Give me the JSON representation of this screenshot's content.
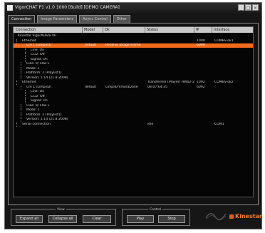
{
  "window": {
    "title": "VigorCHAT P1 v1.0 1000 [Build] [DEMO CAMERA]",
    "close": "×",
    "minimize": "_",
    "maximize": "□"
  },
  "tabs": [
    {
      "label": "Connection",
      "active": true
    },
    {
      "label": "Image Parameters",
      "active": false
    },
    {
      "label": "Async Control",
      "active": false
    },
    {
      "label": "Other",
      "active": false
    }
  ],
  "grid": {
    "headers": [
      "Connection",
      "Model",
      "Ok",
      "Status",
      "IP",
      "Interface"
    ],
    "rows": [
      {
        "c0": "Kinestar VigorXData VP",
        "c1": "",
        "c2": "",
        "c3": "",
        "c4": "",
        "c5": "",
        "indent": 0,
        "selected": false
      },
      {
        "c0": "Ethernet",
        "c1": "",
        "c2": "",
        "c3": "",
        "c4": "1000",
        "c5": "COMBv-ok1",
        "indent": 1,
        "selected": false
      },
      {
        "c0": "Cm 1 (Limpid1)",
        "c1": "default",
        "c2": "Receive image Frame",
        "c3": "",
        "c4": "6090",
        "c5": "",
        "indent": 2,
        "selected": true
      },
      {
        "c0": "Line: On",
        "c1": "",
        "c2": "",
        "c3": "",
        "c4": "",
        "c5": "",
        "indent": 3,
        "selected": false
      },
      {
        "c0": "CCD: Off",
        "c1": "",
        "c2": "",
        "c3": "",
        "c4": "",
        "c5": "",
        "indent": 3,
        "selected": false
      },
      {
        "c0": "Signal: On",
        "c1": "",
        "c2": "",
        "c3": "",
        "c4": "",
        "c5": "",
        "indent": 3,
        "selected": false
      },
      {
        "c0": "Clas: 0/ Clas L",
        "c1": "",
        "c2": "",
        "c3": "",
        "c4": "",
        "c5": "",
        "indent": 2,
        "selected": false
      },
      {
        "c0": "Mode: 1",
        "c1": "",
        "c2": "",
        "c3": "",
        "c4": "",
        "c5": "",
        "indent": 2,
        "selected": false
      },
      {
        "c0": "Platform: 2 (Playlist1)",
        "c1": "",
        "c2": "",
        "c3": "",
        "c4": "",
        "c5": "",
        "indent": 2,
        "selected": false
      },
      {
        "c0": "Version: 1.14 (21.8.2008)",
        "c1": "",
        "c2": "",
        "c3": "",
        "c4": "",
        "c5": "",
        "indent": 2,
        "selected": false
      },
      {
        "c0": "Ethernet",
        "c1": "",
        "c2": "",
        "c3": "Transferred TPlayer/ HW02-2",
        "c4": "1092",
        "c5": "COMBv-ok2",
        "indent": 1,
        "selected": false
      },
      {
        "c0": "Cm 1 (Limpid2)",
        "c1": "default",
        "c2": "Limpid/mmoraDone",
        "c3": "08:07:64:35",
        "c4": "6092",
        "c5": "",
        "indent": 2,
        "selected": false
      },
      {
        "c0": "Line: On",
        "c1": "",
        "c2": "",
        "c3": "",
        "c4": "",
        "c5": "",
        "indent": 3,
        "selected": false
      },
      {
        "c0": "CCD: Off",
        "c1": "",
        "c2": "",
        "c3": "",
        "c4": "",
        "c5": "",
        "indent": 3,
        "selected": false
      },
      {
        "c0": "Signal: On",
        "c1": "",
        "c2": "",
        "c3": "",
        "c4": "",
        "c5": "",
        "indent": 3,
        "selected": false
      },
      {
        "c0": "Clas: 0/ Clas L",
        "c1": "",
        "c2": "",
        "c3": "",
        "c4": "",
        "c5": "",
        "indent": 2,
        "selected": false
      },
      {
        "c0": "Mode: 1",
        "c1": "",
        "c2": "",
        "c3": "",
        "c4": "",
        "c5": "",
        "indent": 2,
        "selected": false
      },
      {
        "c0": "Platform: 2 (Playlist1)",
        "c1": "",
        "c2": "",
        "c3": "",
        "c4": "",
        "c5": "",
        "indent": 2,
        "selected": false
      },
      {
        "c0": "Version: 1.14 (21.8.2008)",
        "c1": "",
        "c2": "",
        "c3": "",
        "c4": "",
        "c5": "",
        "indent": 2,
        "selected": false
      },
      {
        "c0": "Serial connection",
        "c1": "",
        "c2": "",
        "c3": "idle",
        "c4": "",
        "c5": "COM1",
        "indent": 1,
        "selected": false
      }
    ]
  },
  "groups": {
    "view_label": "View",
    "control_label": "Control",
    "expand_all": "Expand all",
    "collapse_all": "Collapse all",
    "clear": "Clear",
    "play": "Play",
    "stop": "Stop"
  },
  "logo": {
    "text": "Kinestar"
  },
  "colors": {
    "selection": "#f26a1b",
    "logo": "#f07a2a"
  }
}
